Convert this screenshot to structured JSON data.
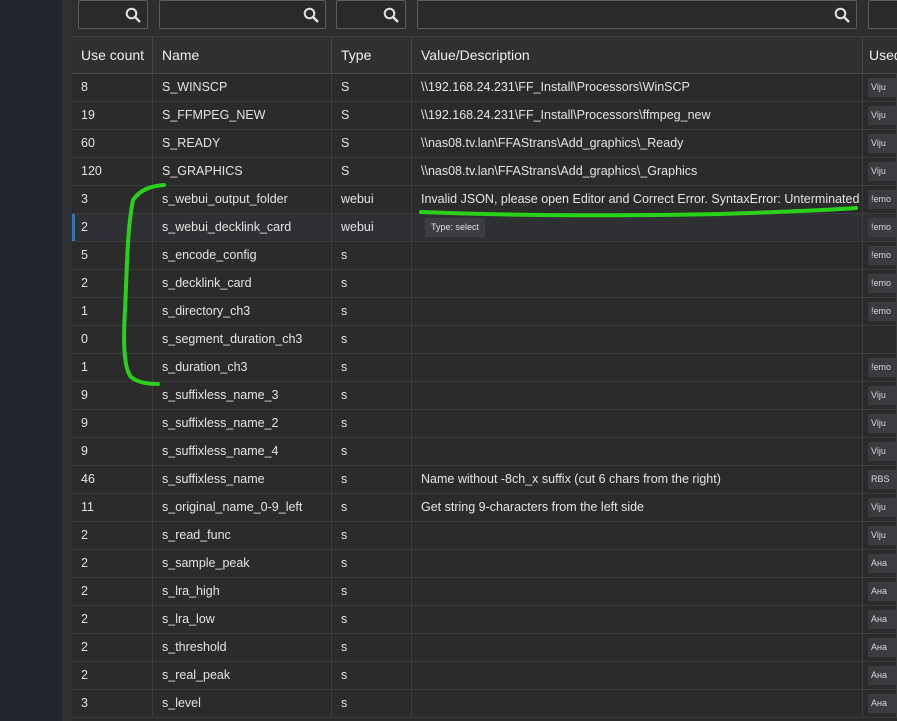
{
  "columns": {
    "use_count": "Use count",
    "name": "Name",
    "type": "Type",
    "value": "Value/Description",
    "used_by": "Used"
  },
  "rows": [
    {
      "count": "8",
      "name": "S_WINSCP",
      "type": "S",
      "value": "\\\\192.168.24.231\\FF_Install\\Processors\\WinSCP",
      "used": "Viju"
    },
    {
      "count": "19",
      "name": "S_FFMPEG_NEW",
      "type": "S",
      "value": "\\\\192.168.24.231\\FF_Install\\Processors\\ffmpeg_new",
      "used": "Viju"
    },
    {
      "count": "60",
      "name": "S_READY",
      "type": "S",
      "value": "\\\\nas08.tv.lan\\FFAStrans\\Add_graphics\\_Ready",
      "used": "Viju"
    },
    {
      "count": "120",
      "name": "S_GRAPHICS",
      "type": "S",
      "value": "\\\\nas08.tv.lan\\FFAStrans\\Add_graphics\\_Graphics",
      "used": "Viju"
    },
    {
      "count": "3",
      "name": "s_webui_output_folder",
      "type": "webui",
      "value": "Invalid JSON, please open Editor and Correct Error. SyntaxError: Unterminated str",
      "used": "!emo"
    },
    {
      "count": "2",
      "name": "s_webui_decklink_card",
      "type": "webui",
      "value": "",
      "chip": "Type: select",
      "used": "!emo"
    },
    {
      "count": "5",
      "name": "s_encode_config",
      "type": "s",
      "value": "",
      "used": "!emo"
    },
    {
      "count": "2",
      "name": "s_decklink_card",
      "type": "s",
      "value": "",
      "used": "!emo"
    },
    {
      "count": "1",
      "name": "s_directory_ch3",
      "type": "s",
      "value": "",
      "used": "!emo"
    },
    {
      "count": "0",
      "name": "s_segment_duration_ch3",
      "type": "s",
      "value": "",
      "used": ""
    },
    {
      "count": "1",
      "name": "s_duration_ch3",
      "type": "s",
      "value": "",
      "used": "!emo"
    },
    {
      "count": "9",
      "name": "s_suffixless_name_3",
      "type": "s",
      "value": "",
      "used": "Viju"
    },
    {
      "count": "9",
      "name": "s_suffixless_name_2",
      "type": "s",
      "value": "",
      "used": "Viju"
    },
    {
      "count": "9",
      "name": "s_suffixless_name_4",
      "type": "s",
      "value": "",
      "used": "Viju"
    },
    {
      "count": "46",
      "name": "s_suffixless_name",
      "type": "s",
      "value": "Name without -8ch_x suffix (cut 6 chars from the right)",
      "used": "RBS"
    },
    {
      "count": "11",
      "name": "s_original_name_0-9_left",
      "type": "s",
      "value": "Get string 9-characters from the left side",
      "used": "Viju"
    },
    {
      "count": "2",
      "name": "s_read_func",
      "type": "s",
      "value": "",
      "used": "Viju"
    },
    {
      "count": "2",
      "name": "s_sample_peak",
      "type": "s",
      "value": "",
      "used": "Ана"
    },
    {
      "count": "2",
      "name": "s_lra_high",
      "type": "s",
      "value": "",
      "used": "Ана"
    },
    {
      "count": "2",
      "name": "s_lra_low",
      "type": "s",
      "value": "",
      "used": "Ана"
    },
    {
      "count": "2",
      "name": "s_threshold",
      "type": "s",
      "value": "",
      "used": "Ана"
    },
    {
      "count": "2",
      "name": "s_real_peak",
      "type": "s",
      "value": "",
      "used": "Ана"
    },
    {
      "count": "3",
      "name": "s_level",
      "type": "s",
      "value": "",
      "used": "Ана"
    }
  ],
  "colors": {
    "annotation": "#29d11a",
    "selected_accent": "#3a6fb0"
  },
  "icons": {
    "filter": "search-icon"
  }
}
